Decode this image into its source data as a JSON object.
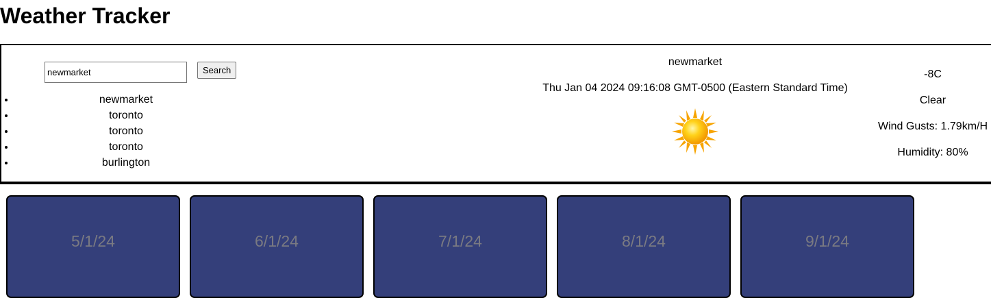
{
  "page": {
    "title": "Weather Tracker"
  },
  "search": {
    "value": "newmarket",
    "button_label": "Search"
  },
  "history": [
    "newmarket",
    "toronto",
    "toronto",
    "toronto",
    "burlington"
  ],
  "current": {
    "city": "newmarket",
    "datetime": "Thu Jan 04 2024 09:16:08 GMT-0500 (Eastern Standard Time)",
    "icon": "sun-icon",
    "temperature": "-8C",
    "condition": "Clear",
    "wind": "Wind Gusts: 1.79km/H",
    "humidity": "Humidity: 80%"
  },
  "forecast": [
    {
      "date": "5/1/24"
    },
    {
      "date": "6/1/24"
    },
    {
      "date": "7/1/24"
    },
    {
      "date": "8/1/24"
    },
    {
      "date": "9/1/24"
    }
  ],
  "colors": {
    "card_background": "#343f7a",
    "card_date_text": "#7a7a82"
  }
}
